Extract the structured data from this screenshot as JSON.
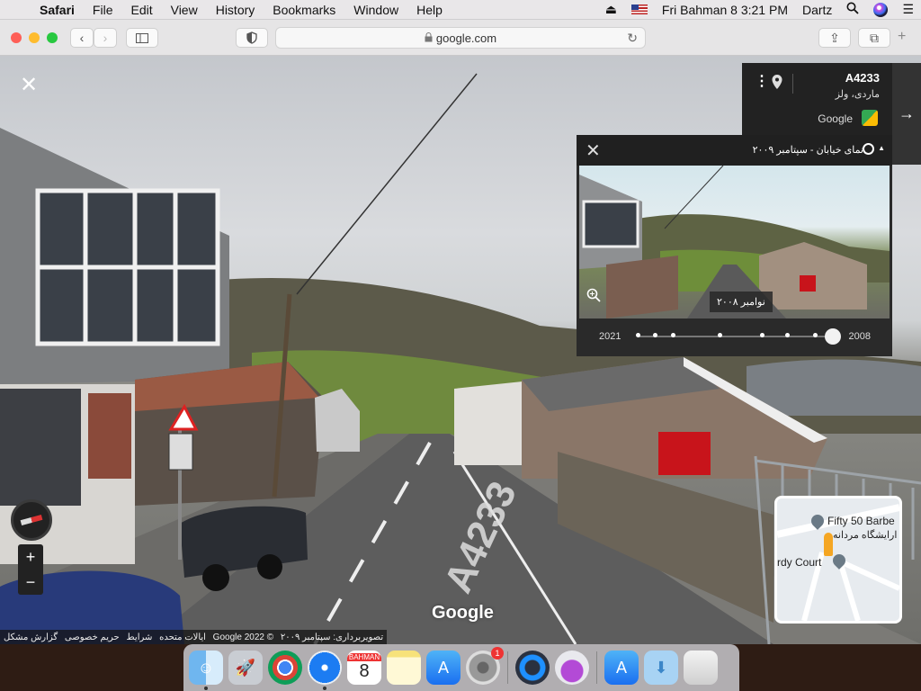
{
  "menubar": {
    "app_name": "Safari",
    "menus": [
      "File",
      "Edit",
      "View",
      "History",
      "Bookmarks",
      "Window",
      "Help"
    ],
    "datetime": "Fri Bahman 8  3:21 PM",
    "user": "Dartz"
  },
  "toolbar": {
    "url": "google.com"
  },
  "info_card": {
    "title": "A4233",
    "subtitle": "ماردی، ولز",
    "google_label": "Google"
  },
  "time_travel": {
    "title": "نمای خیابان - سپتامبر ۲۰۰۹",
    "badge": "نوامبر ۲۰۰۸",
    "year_start": "2021",
    "year_end": "2008",
    "dot_count": 7,
    "selected_position": 1.0
  },
  "minimap": {
    "place1": "Fifty 50 Barbe",
    "place2": "ارایشگاه مردانه",
    "place3": "rdy Court"
  },
  "logo": "Google",
  "footer": {
    "items": [
      "تصویربرداری: سپتامبر ۲۰۰۹",
      "© 2022 Google",
      "ایالات متحده",
      "شرایط",
      "حریم خصوصی",
      "گزارش مشکل"
    ]
  },
  "dock": {
    "calendar_month": "BAHMAN",
    "calendar_day": "8",
    "settings_badge": "1"
  },
  "colors": {
    "menubar_bg": "#e9e7e9",
    "panel_bg": "#2a2a2a",
    "accent_orange": "#f5a623"
  }
}
